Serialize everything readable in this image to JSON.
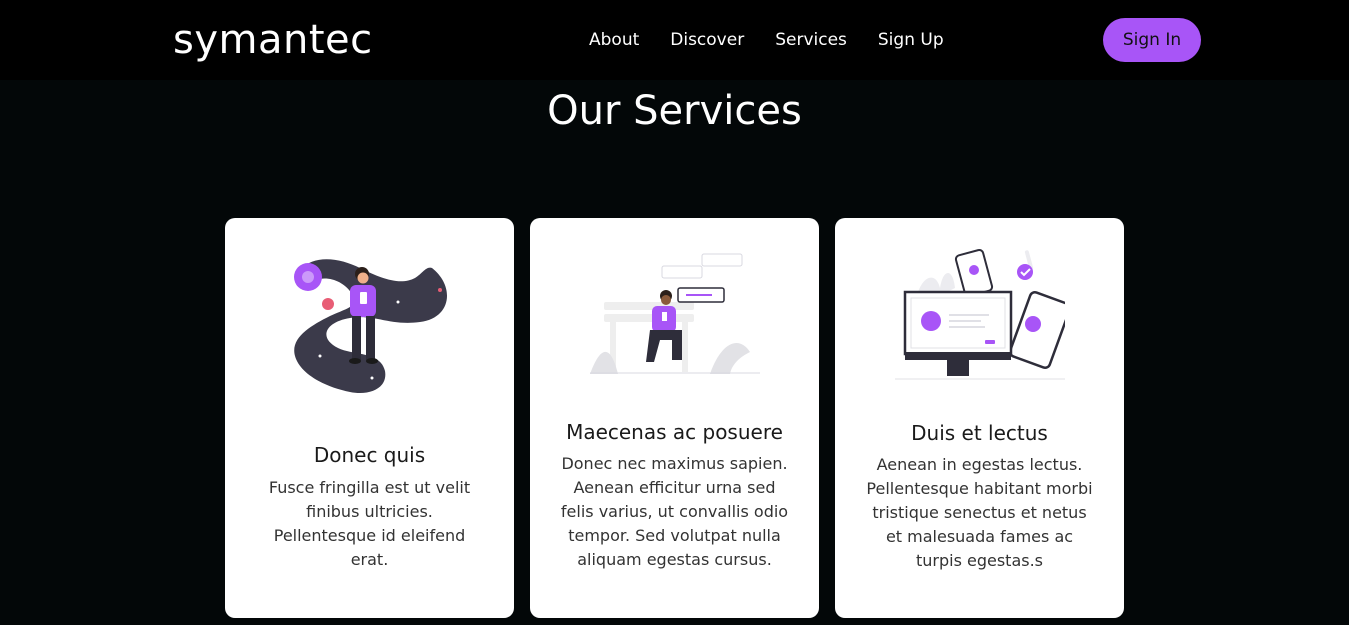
{
  "header": {
    "logo": "symantec",
    "nav": [
      "About",
      "Discover",
      "Services",
      "Sign Up"
    ],
    "signin_label": "Sign In",
    "accent_color": "#a855f7"
  },
  "services": {
    "title": "Our Services",
    "cards": [
      {
        "icon": "person-space-illustration",
        "title": "Donec quis",
        "text": "Fusce fringilla est ut velit finibus ultricies. Pellentesque id eleifend erat."
      },
      {
        "icon": "person-bench-chat-illustration",
        "title": "Maecenas ac posuere",
        "text": "Donec nec maximus sapien. Aenean efficitur urna sed felis varius, ut convallis odio tempor. Sed volutpat nulla aliquam egestas cursus."
      },
      {
        "icon": "devices-illustration",
        "title": "Duis et lectus",
        "text": "Aenean in egestas lectus. Pellentesque habitant morbi tristique senectus et netus et malesuada fames ac turpis egestas.s"
      }
    ]
  }
}
